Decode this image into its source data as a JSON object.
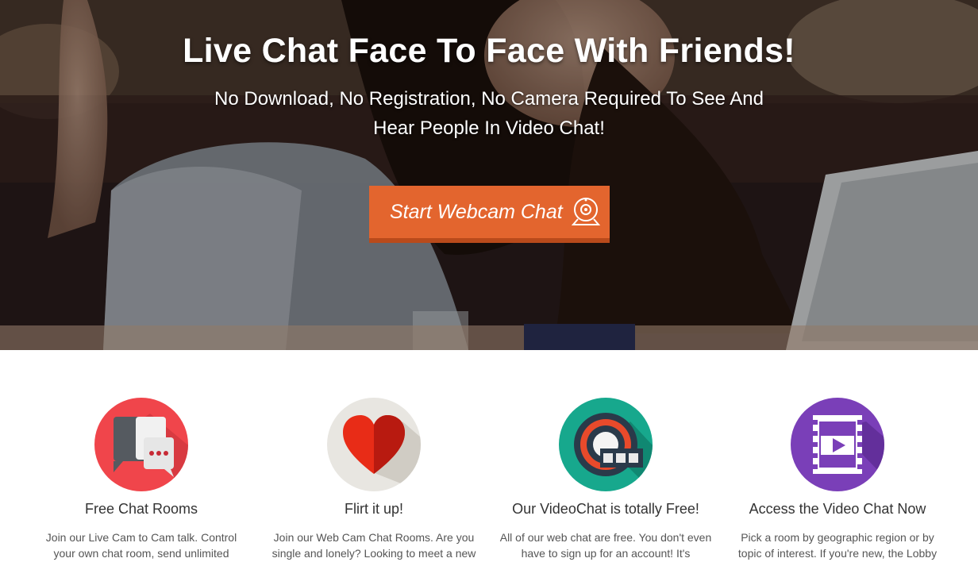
{
  "hero": {
    "title": "Live Chat Face To Face With Friends!",
    "subtitle_line1": "No Download, No Registration, No Camera Required To See And",
    "subtitle_line2": "Hear People In Video Chat!",
    "cta_label": "Start Webcam Chat",
    "cta_icon": "webcam-icon"
  },
  "colors": {
    "cta": "#e3652e",
    "chat_circle": "#f0454b",
    "heart_circle": "#e8e6e1",
    "video_circle": "#17a88d",
    "film_circle": "#7a3fb8"
  },
  "features": [
    {
      "title": "Free Chat Rooms",
      "text": "Join our Live Cam to Cam talk. Control your own chat room, send unlimited",
      "icon": "chat-bubbles-icon"
    },
    {
      "title": "Flirt it up!",
      "text": "Join our Web Cam Chat Rooms. Are you single and lonely? Looking to meet a new",
      "icon": "heart-icon"
    },
    {
      "title": "Our VideoChat is totally Free!",
      "text": "All of our web chat are free. You don't even have to sign up for an account! It's",
      "icon": "film-reel-icon"
    },
    {
      "title": "Access the Video Chat Now",
      "text": "Pick a room by geographic region or by topic of interest. If you're new, the Lobby",
      "icon": "video-film-icon"
    }
  ]
}
